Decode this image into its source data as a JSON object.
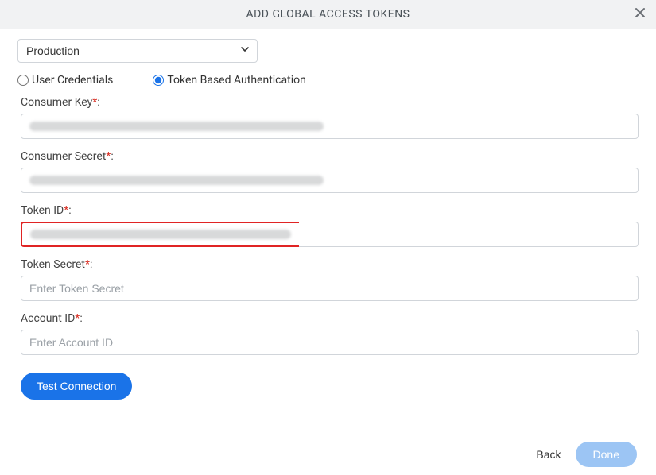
{
  "header": {
    "title": "ADD GLOBAL ACCESS TOKENS"
  },
  "env": {
    "selected": "Production"
  },
  "auth": {
    "user_credentials_label": "User Credentials",
    "token_based_label": "Token Based Authentication"
  },
  "fields": {
    "consumer_key": {
      "label": "Consumer Key",
      "value_redacted": true
    },
    "consumer_secret": {
      "label": "Consumer Secret",
      "value_redacted": true
    },
    "token_id": {
      "label": "Token ID",
      "value_redacted": true,
      "highlighted": true
    },
    "token_secret": {
      "label": "Token Secret",
      "placeholder": "Enter Token Secret"
    },
    "account_id": {
      "label": "Account ID",
      "placeholder": "Enter Account ID"
    }
  },
  "buttons": {
    "test_connection": "Test Connection",
    "back": "Back",
    "done": "Done"
  }
}
